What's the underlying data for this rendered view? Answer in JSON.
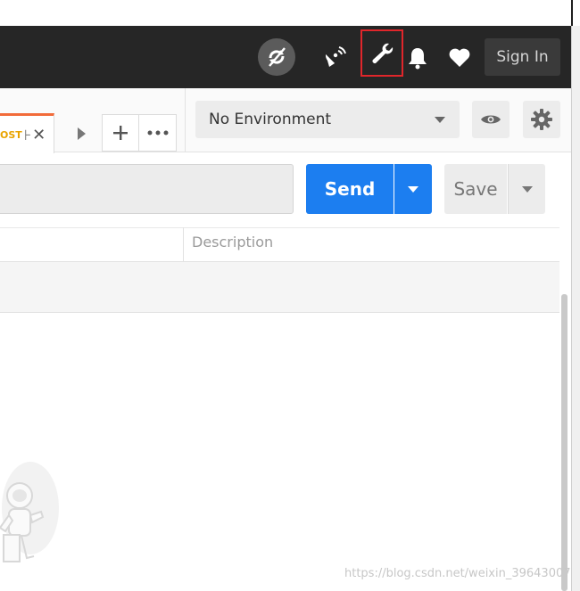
{
  "header": {
    "icons": [
      "sync-off-icon",
      "satellite-icon",
      "wrench-icon",
      "bell-icon",
      "heart-icon"
    ],
    "sign_in_label": "Sign In",
    "highlight_color": "#e0262b"
  },
  "tabs": {
    "active": {
      "method": "OST",
      "rest": "⊦",
      "close": "✕"
    },
    "add_label": "+",
    "more_label": "•••"
  },
  "environment": {
    "selected": "No Environment"
  },
  "request": {
    "url_value": "",
    "send_label": "Send",
    "save_label": "Save"
  },
  "params_table": {
    "columns": [
      "",
      "Description"
    ]
  },
  "watermark": "https://blog.csdn.net/weixin_39643007",
  "colors": {
    "header_bg": "#262626",
    "send": "#1c7ef0",
    "method": "#e9a400",
    "tab_accent": "#f26b3a"
  }
}
